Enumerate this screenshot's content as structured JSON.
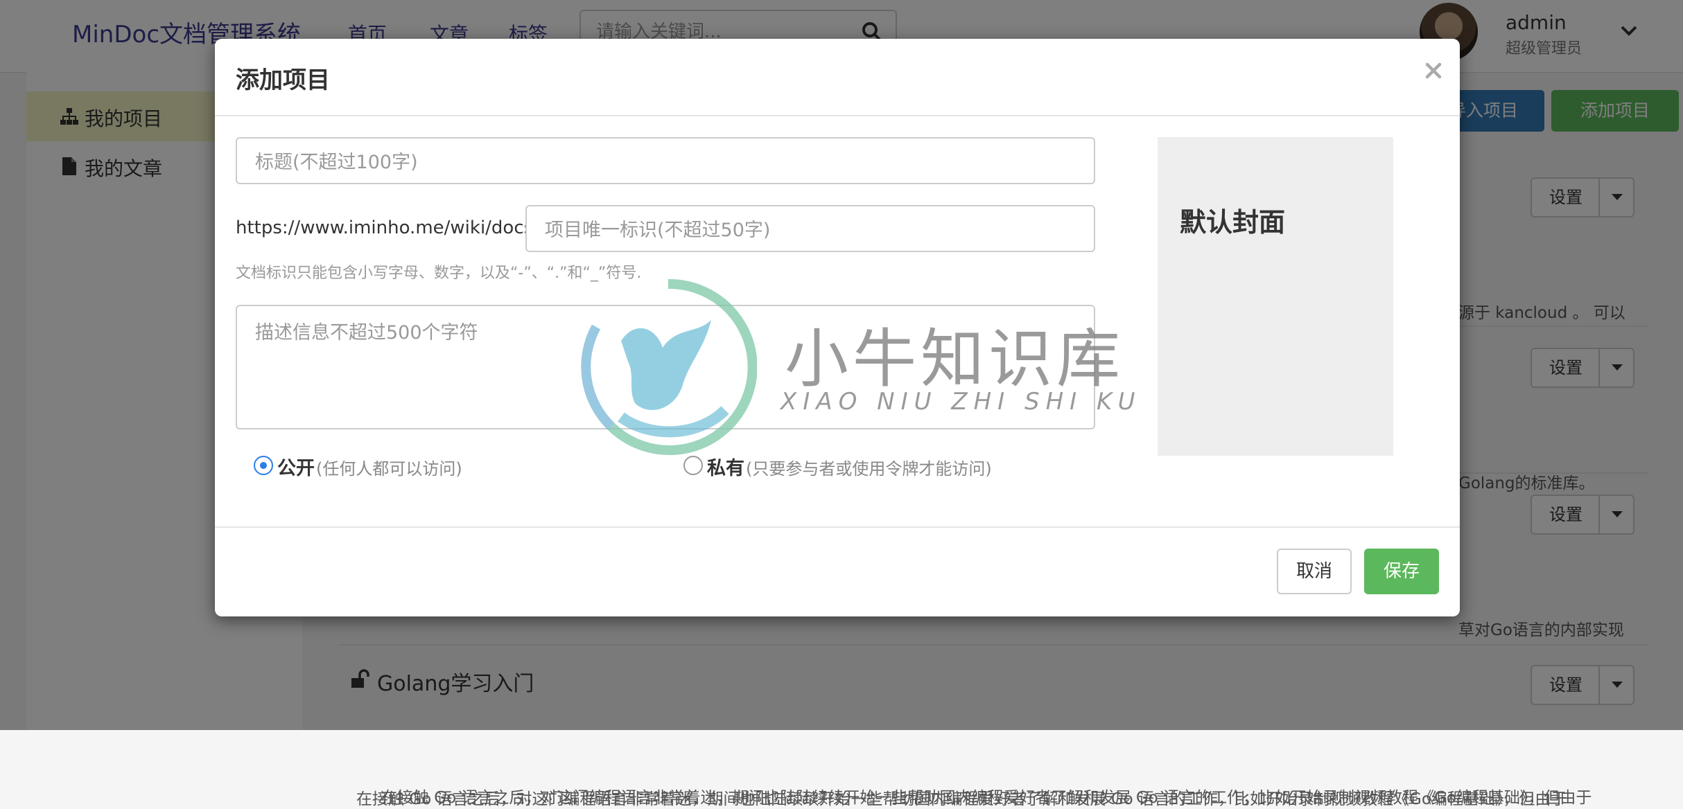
{
  "navbar": {
    "brand": "MinDoc文档管理系统",
    "links": [
      "首页",
      "文章",
      "标签"
    ],
    "search_placeholder": "请输入关键词...",
    "user": {
      "name": "admin",
      "role": "超级管理员"
    }
  },
  "sidebar": {
    "items": [
      {
        "label": "我的项目",
        "icon": "sitemap-icon",
        "active": true
      },
      {
        "label": "我的文章",
        "icon": "file-icon",
        "active": false
      }
    ]
  },
  "main": {
    "import_button": "导入项目",
    "add_button": "添加项目",
    "settings_label": "设置",
    "projects": [
      {
        "desc_fragment": "源于 kancloud 。 可以"
      },
      {
        "desc_fragment": "Golang的标准库。"
      },
      {
        "desc_fragment": "草对Go语言的内部实现"
      },
      {
        "title": "Golang学习入门",
        "desc_fragment": "在接触 Go 语言之后，对这门编程语言非常着迷，期间也陆陆续续开始一些帮助国内编程爱好者了解和发展 Go 语言的工作，比如开始录制视频教程《Go编程基础》，但由于"
      }
    ]
  },
  "modal": {
    "title": "添加项目",
    "close_glyph": "×",
    "title_placeholder": "标题(不超过100字)",
    "url_prefix": "https://www.iminho.me/wiki/docs/",
    "identify_placeholder": "项目唯一标识(不超过50字)",
    "identify_help": "文档标识只能包含小写字母、数字，以及“-”、“.”和“_”符号.",
    "description_placeholder": "描述信息不超过500个字符",
    "visibility": {
      "public_label": "公开",
      "public_hint": "(任何人都可以访问)",
      "private_label": "私有",
      "private_hint": "(只要参与者或使用令牌才能访问)",
      "selected": "public"
    },
    "cover_label": "默认封面",
    "cancel_button": "取消",
    "save_button": "保存"
  },
  "watermark": {
    "text": "小牛知识库",
    "subtext": "XIAO NIU ZHI SHI KU"
  },
  "colors": {
    "primary_blue": "#337ab7",
    "success_green": "#5cb85c",
    "radio_blue": "#2b7de9",
    "brand_text": "#3b3b8f"
  }
}
